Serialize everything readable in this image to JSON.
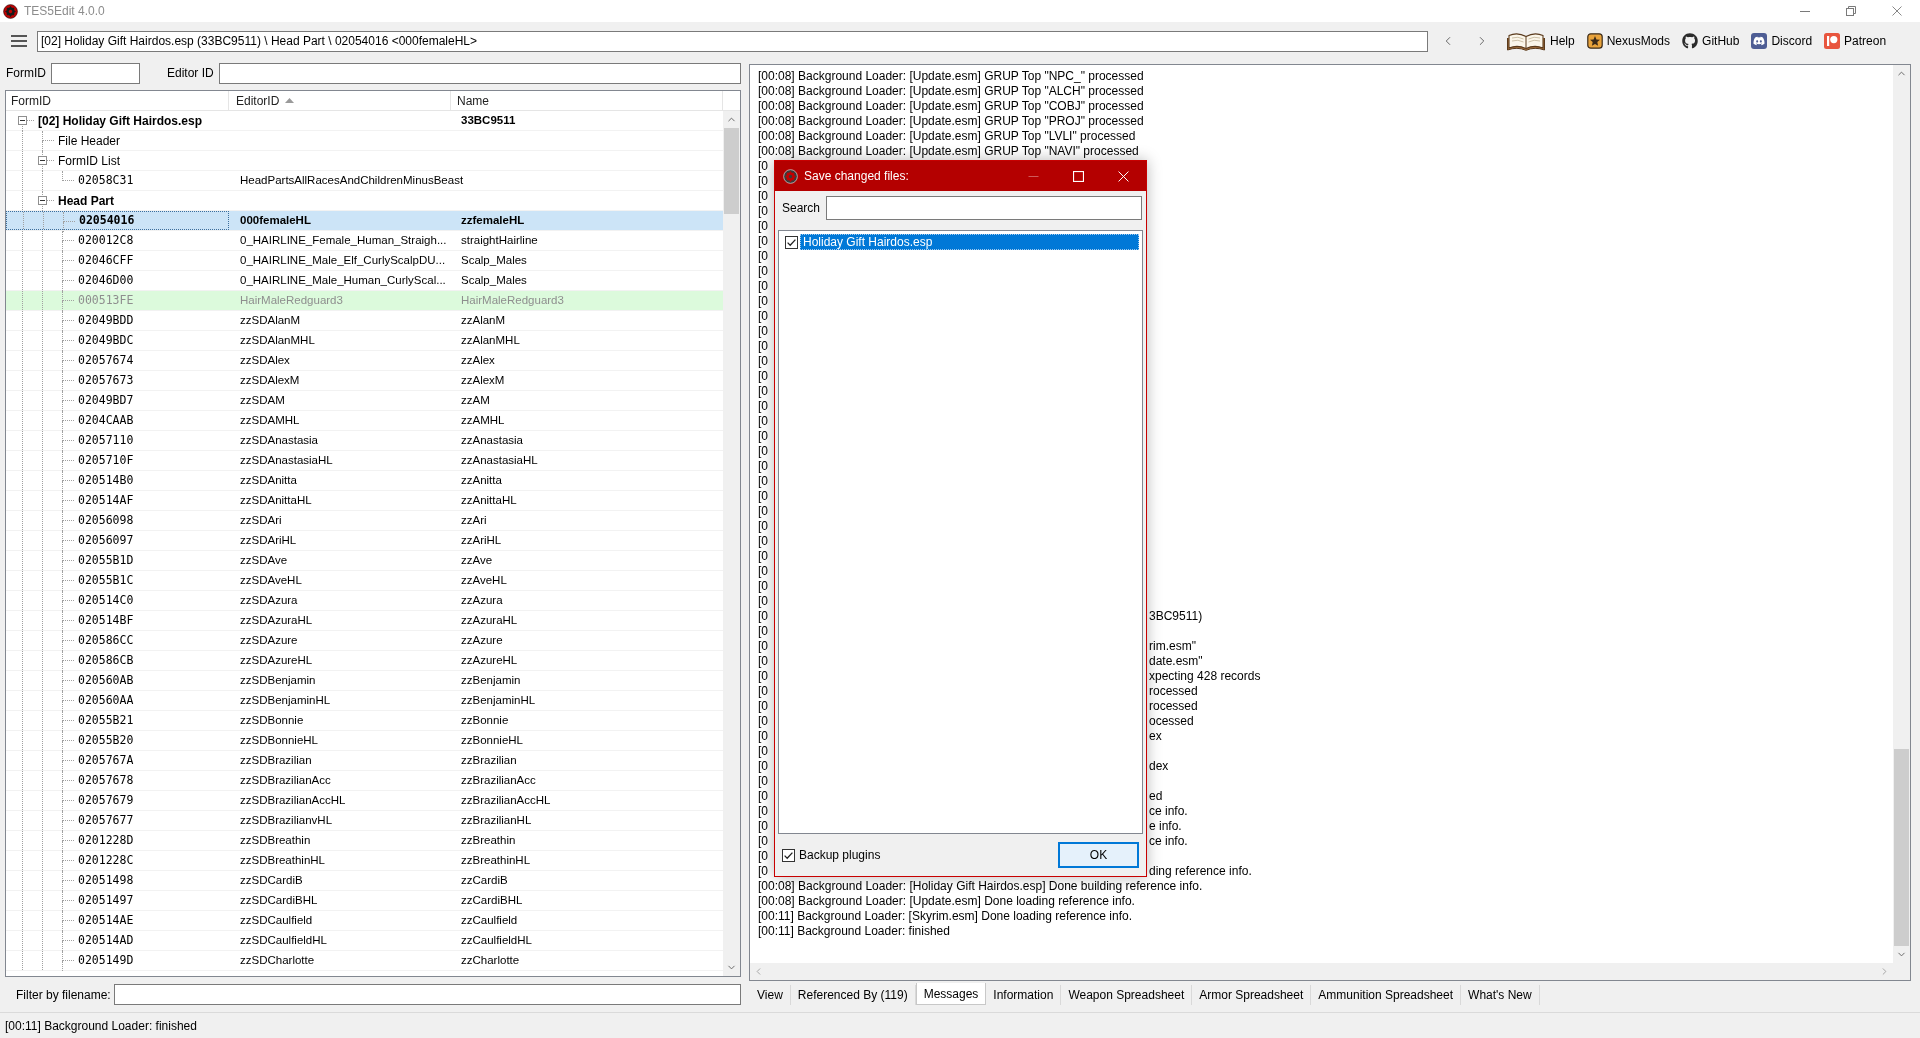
{
  "window": {
    "title": "TES5Edit 4.0.0"
  },
  "toolbar": {
    "path": "[02] Holiday Gift Hairdos.esp (33BC9511) \\ Head Part \\ 02054016 <000femaleHL>",
    "links": [
      {
        "kind": "help",
        "label": "Help"
      },
      {
        "kind": "nexusmods",
        "label": "NexusMods"
      },
      {
        "kind": "github",
        "label": "GitHub"
      },
      {
        "kind": "discord",
        "label": "Discord"
      },
      {
        "kind": "patreon",
        "label": "Patreon"
      }
    ]
  },
  "filters": {
    "form_id": {
      "label": "FormID"
    },
    "editor_id": {
      "label": "Editor ID"
    }
  },
  "tree": {
    "columns": [
      {
        "label": "FormID"
      },
      {
        "label": "EditorID",
        "sorted": true
      },
      {
        "label": "Name"
      }
    ],
    "nodes": [
      {
        "form_id": "[02] Holiday Gift Hairdos.esp",
        "name": "33BC9511",
        "expanded": true,
        "selected": false,
        "modified": true,
        "children": [
          {
            "form_id": "File Header",
            "selected": false,
            "modified": false
          },
          {
            "form_id": "FormID List",
            "expanded": true,
            "selected": false,
            "modified": false,
            "children": [
              {
                "kind": "record",
                "form_id": "02058C31",
                "editor_id": "HeadPartsAllRacesAndChildrenMinusBeast",
                "selected": false,
                "modified": false,
                "dimmed": false
              }
            ]
          },
          {
            "form_id": "Head Part",
            "expanded": true,
            "selected": false,
            "modified": true,
            "children": [
              {
                "kind": "record",
                "form_id": "02054016",
                "editor_id": "000femaleHL",
                "name": "zzfemaleHL",
                "selected": true,
                "modified": true,
                "dimmed": false
              },
              {
                "kind": "record",
                "form_id": "020012C8",
                "editor_id": "0_HAIRLINE_Female_Human_Straigh...",
                "name": "straightHairline",
                "selected": false,
                "modified": false,
                "dimmed": false
              },
              {
                "kind": "record",
                "form_id": "02046CFF",
                "editor_id": "0_HAIRLINE_Male_Elf_CurlyScalpDU...",
                "name": "Scalp_Males",
                "selected": false,
                "modified": false,
                "dimmed": false
              },
              {
                "kind": "record",
                "form_id": "02046D00",
                "editor_id": "0_HAIRLINE_Male_Human_CurlyScal...",
                "name": "Scalp_Males",
                "selected": false,
                "modified": false,
                "dimmed": false
              },
              {
                "kind": "record",
                "form_id": "000513FE",
                "editor_id": "HairMaleRedguard3",
                "name": "HairMaleRedguard3",
                "selected": false,
                "modified": false,
                "dimmed": true,
                "color": "#dcfadc"
              },
              {
                "kind": "record",
                "form_id": "02049BDD",
                "editor_id": "zzSDAlanM",
                "name": "zzAlanM",
                "selected": false,
                "modified": false,
                "dimmed": false
              },
              {
                "kind": "record",
                "form_id": "02049BDC",
                "editor_id": "zzSDAlanMHL",
                "name": "zzAlanMHL",
                "selected": false,
                "modified": false,
                "dimmed": false
              },
              {
                "kind": "record",
                "form_id": "02057674",
                "editor_id": "zzSDAlex",
                "name": "zzAlex",
                "selected": false,
                "modified": false,
                "dimmed": false
              },
              {
                "kind": "record",
                "form_id": "02057673",
                "editor_id": "zzSDAlexM",
                "name": "zzAlexM",
                "selected": false,
                "modified": false,
                "dimmed": false
              },
              {
                "kind": "record",
                "form_id": "02049BD7",
                "editor_id": "zzSDAM",
                "name": "zzAM",
                "selected": false,
                "modified": false,
                "dimmed": false
              },
              {
                "kind": "record",
                "form_id": "0204CAAB",
                "editor_id": "zzSDAMHL",
                "name": "zzAMHL",
                "selected": false,
                "modified": false,
                "dimmed": false
              },
              {
                "kind": "record",
                "form_id": "02057110",
                "editor_id": "zzSDAnastasia",
                "name": "zzAnastasia",
                "selected": false,
                "modified": false,
                "dimmed": false
              },
              {
                "kind": "record",
                "form_id": "0205710F",
                "editor_id": "zzSDAnastasiaHL",
                "name": "zzAnastasiaHL",
                "selected": false,
                "modified": false,
                "dimmed": false
              },
              {
                "kind": "record",
                "form_id": "020514B0",
                "editor_id": "zzSDAnitta",
                "name": "zzAnitta",
                "selected": false,
                "modified": false,
                "dimmed": false
              },
              {
                "kind": "record",
                "form_id": "020514AF",
                "editor_id": "zzSDAnittaHL",
                "name": "zzAnittaHL",
                "selected": false,
                "modified": false,
                "dimmed": false
              },
              {
                "kind": "record",
                "form_id": "02056098",
                "editor_id": "zzSDAri",
                "name": "zzAri",
                "selected": false,
                "modified": false,
                "dimmed": false
              },
              {
                "kind": "record",
                "form_id": "02056097",
                "editor_id": "zzSDAriHL",
                "name": "zzAriHL",
                "selected": false,
                "modified": false,
                "dimmed": false
              },
              {
                "kind": "record",
                "form_id": "02055B1D",
                "editor_id": "zzSDAve",
                "name": "zzAve",
                "selected": false,
                "modified": false,
                "dimmed": false
              },
              {
                "kind": "record",
                "form_id": "02055B1C",
                "editor_id": "zzSDAveHL",
                "name": "zzAveHL",
                "selected": false,
                "modified": false,
                "dimmed": false
              },
              {
                "kind": "record",
                "form_id": "020514C0",
                "editor_id": "zzSDAzura",
                "name": "zzAzura",
                "selected": false,
                "modified": false,
                "dimmed": false
              },
              {
                "kind": "record",
                "form_id": "020514BF",
                "editor_id": "zzSDAzuraHL",
                "name": "zzAzuraHL",
                "selected": false,
                "modified": false,
                "dimmed": false
              },
              {
                "kind": "record",
                "form_id": "020586CC",
                "editor_id": "zzSDAzure",
                "name": "zzAzure",
                "selected": false,
                "modified": false,
                "dimmed": false
              },
              {
                "kind": "record",
                "form_id": "020586CB",
                "editor_id": "zzSDAzureHL",
                "name": "zzAzureHL",
                "selected": false,
                "modified": false,
                "dimmed": false
              },
              {
                "kind": "record",
                "form_id": "020560AB",
                "editor_id": "zzSDBenjamin",
                "name": "zzBenjamin",
                "selected": false,
                "modified": false,
                "dimmed": false
              },
              {
                "kind": "record",
                "form_id": "020560AA",
                "editor_id": "zzSDBenjaminHL",
                "name": "zzBenjaminHL",
                "selected": false,
                "modified": false,
                "dimmed": false
              },
              {
                "kind": "record",
                "form_id": "02055B21",
                "editor_id": "zzSDBonnie",
                "name": "zzBonnie",
                "selected": false,
                "modified": false,
                "dimmed": false
              },
              {
                "kind": "record",
                "form_id": "02055B20",
                "editor_id": "zzSDBonnieHL",
                "name": "zzBonnieHL",
                "selected": false,
                "modified": false,
                "dimmed": false
              },
              {
                "kind": "record",
                "form_id": "0205767A",
                "editor_id": "zzSDBrazilian",
                "name": "zzBrazilian",
                "selected": false,
                "modified": false,
                "dimmed": false
              },
              {
                "kind": "record",
                "form_id": "02057678",
                "editor_id": "zzSDBrazilianAcc",
                "name": "zzBrazilianAcc",
                "selected": false,
                "modified": false,
                "dimmed": false
              },
              {
                "kind": "record",
                "form_id": "02057679",
                "editor_id": "zzSDBrazilianAccHL",
                "name": "zzBrazilianAccHL",
                "selected": false,
                "modified": false,
                "dimmed": false
              },
              {
                "kind": "record",
                "form_id": "02057677",
                "editor_id": "zzSDBrazilianvHL",
                "name": "zzBrazilianHL",
                "selected": false,
                "modified": false,
                "dimmed": false
              },
              {
                "kind": "record",
                "form_id": "0201228D",
                "editor_id": "zzSDBreathin",
                "name": "zzBreathin",
                "selected": false,
                "modified": false,
                "dimmed": false
              },
              {
                "kind": "record",
                "form_id": "0201228C",
                "editor_id": "zzSDBreathinHL",
                "name": "zzBreathinHL",
                "selected": false,
                "modified": false,
                "dimmed": false
              },
              {
                "kind": "record",
                "form_id": "02051498",
                "editor_id": "zzSDCardiB",
                "name": "zzCardiB",
                "selected": false,
                "modified": false,
                "dimmed": false
              },
              {
                "kind": "record",
                "form_id": "02051497",
                "editor_id": "zzSDCardiBHL",
                "name": "zzCardiBHL",
                "selected": false,
                "modified": false,
                "dimmed": false
              },
              {
                "kind": "record",
                "form_id": "020514AE",
                "editor_id": "zzSDCaulfield",
                "name": "zzCaulfield",
                "selected": false,
                "modified": false,
                "dimmed": false
              },
              {
                "kind": "record",
                "form_id": "020514AD",
                "editor_id": "zzSDCaulfieldHL",
                "name": "zzCaulfieldHL",
                "selected": false,
                "modified": false,
                "dimmed": false
              },
              {
                "kind": "record",
                "form_id": "0205149D",
                "editor_id": "zzSDCharlotte",
                "name": "zzCharlotte",
                "selected": false,
                "modified": false,
                "dimmed": false
              }
            ]
          }
        ]
      }
    ]
  },
  "filename_filter": {
    "label": "Filter by filename:"
  },
  "messages": {
    "lines": [
      {
        "text": "[00:08] Background Loader: [Update.esm] GRUP Top \"NPC_\" processed"
      },
      {
        "text": "[00:08] Background Loader: [Update.esm] GRUP Top \"ALCH\" processed"
      },
      {
        "text": "[00:08] Background Loader: [Update.esm] GRUP Top \"COBJ\" processed"
      },
      {
        "text": "[00:08] Background Loader: [Update.esm] GRUP Top \"PROJ\" processed"
      },
      {
        "text": "[00:08] Background Loader: [Update.esm] GRUP Top \"LVLI\" processed"
      },
      {
        "text": "[00:08] Background Loader: [Update.esm] GRUP Top \"NAVI\" processed"
      },
      {
        "left": "[0"
      },
      {
        "left": "[0"
      },
      {
        "left": "[0"
      },
      {
        "left": "[0"
      },
      {
        "left": "[0"
      },
      {
        "left": "[0"
      },
      {
        "left": "[0"
      },
      {
        "left": "[0"
      },
      {
        "left": "[0"
      },
      {
        "left": "[0"
      },
      {
        "left": "[0"
      },
      {
        "left": "[0"
      },
      {
        "left": "[0"
      },
      {
        "left": "[0"
      },
      {
        "left": "[0"
      },
      {
        "left": "[0"
      },
      {
        "left": "[0"
      },
      {
        "left": "[0"
      },
      {
        "left": "[0"
      },
      {
        "left": "[0"
      },
      {
        "left": "[0"
      },
      {
        "left": "[0"
      },
      {
        "left": "[0"
      },
      {
        "left": "[0"
      },
      {
        "left": "[0"
      },
      {
        "left": "[0"
      },
      {
        "left": "[0"
      },
      {
        "left": "[0"
      },
      {
        "left": "[0"
      },
      {
        "left": "[0"
      },
      {
        "left": "[0",
        "right": "3BC9511)"
      },
      {
        "left": "[0"
      },
      {
        "left": "[0",
        "right": "rim.esm\""
      },
      {
        "left": "[0",
        "right": "date.esm\""
      },
      {
        "left": "[0",
        "right": "xpecting 428 records"
      },
      {
        "left": "[0",
        "right": "rocessed"
      },
      {
        "left": "[0",
        "right": "rocessed"
      },
      {
        "left": "[0",
        "right": "ocessed"
      },
      {
        "left": "[0",
        "right": "ex"
      },
      {
        "left": "[0"
      },
      {
        "left": "[0",
        "right": "dex"
      },
      {
        "left": "[0"
      },
      {
        "left": "[0",
        "right": "ed"
      },
      {
        "left": "[0",
        "right": "ce info."
      },
      {
        "left": "[0",
        "right": "e info."
      },
      {
        "left": "[0",
        "right": "ce info."
      },
      {
        "left": "[0"
      },
      {
        "left": "[0",
        "right": "ding reference info."
      },
      {
        "text": "[00:08] Background Loader: [Holiday Gift Hairdos.esp] Done building reference info."
      },
      {
        "text": "[00:08] Background Loader: [Update.esm] Done loading reference info."
      },
      {
        "text": "[00:11] Background Loader: [Skyrim.esm] Done loading reference info."
      },
      {
        "text": "[00:11] Background Loader: finished"
      }
    ]
  },
  "tabs": [
    {
      "label": "View",
      "selected": false
    },
    {
      "label": "Referenced By (119)",
      "selected": false
    },
    {
      "label": "Messages",
      "selected": true
    },
    {
      "label": "Information",
      "selected": false
    },
    {
      "label": "Weapon Spreadsheet",
      "selected": false
    },
    {
      "label": "Armor Spreadsheet",
      "selected": false
    },
    {
      "label": "Ammunition Spreadsheet",
      "selected": false
    },
    {
      "label": "What's New",
      "selected": false
    }
  ],
  "dialog": {
    "title": "Save changed files:",
    "window_buttons": [
      {
        "kind": "minimize",
        "disabled": true
      },
      {
        "kind": "maximize",
        "disabled": false
      },
      {
        "kind": "close",
        "disabled": false
      }
    ],
    "search": {
      "label": "Search"
    },
    "files": [
      {
        "label": "Holiday Gift Hairdos.esp",
        "checked": true,
        "selected": true
      }
    ],
    "backup_plugins": {
      "label": "Backup plugins",
      "checked": true
    },
    "buttons": [
      {
        "label": "OK",
        "default": true
      }
    ]
  },
  "status_bar": {
    "text": "[00:11] Background Loader: finished"
  }
}
